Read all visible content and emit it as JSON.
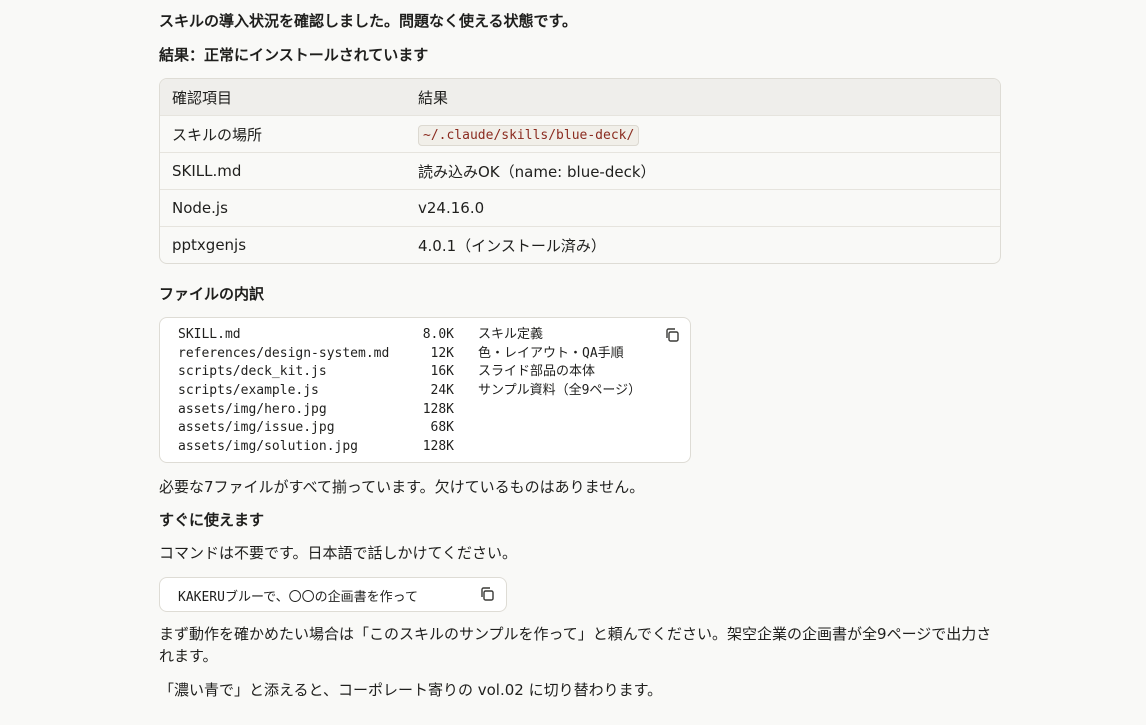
{
  "intro": "スキルの導入状況を確認しました。問題なく使える状態です。",
  "result_heading": "結果：正常にインストールされています",
  "table": {
    "headers": [
      "確認項目",
      "結果"
    ],
    "rows": [
      [
        "スキルの場所",
        "~/.claude/skills/blue-deck/"
      ],
      [
        "SKILL.md",
        "読み込みOK（name: blue-deck）"
      ],
      [
        "Node.js",
        "v24.16.0"
      ],
      [
        "pptxgenjs",
        "4.0.1（インストール済み）"
      ]
    ]
  },
  "files_heading": "ファイルの内訳",
  "files": [
    {
      "path": "SKILL.md",
      "size": "8.0K",
      "desc": "スキル定義"
    },
    {
      "path": "references/design-system.md",
      "size": "12K",
      "desc": "色・レイアウト・QA手順"
    },
    {
      "path": "scripts/deck_kit.js",
      "size": "16K",
      "desc": "スライド部品の本体"
    },
    {
      "path": "scripts/example.js",
      "size": "24K",
      "desc": "サンプル資料（全9ページ）"
    },
    {
      "path": "assets/img/hero.jpg",
      "size": "128K",
      "desc": ""
    },
    {
      "path": "assets/img/issue.jpg",
      "size": "68K",
      "desc": ""
    },
    {
      "path": "assets/img/solution.jpg",
      "size": "128K",
      "desc": ""
    }
  ],
  "files_note": "必要な7ファイルがすべて揃っています。欠けているものはありません。",
  "ready_heading": "すぐに使えます",
  "ready_text": "コマンドは不要です。日本語で話しかけてください。",
  "command": "KAKERUブルーで、〇〇の企画書を作って",
  "sample_text": "まず動作を確かめたい場合は「このスキルのサンプルを作って」と頼んでください。架空企業の企画書が全9ページで出力されます。",
  "variant_text": "「濃い青で」と添えると、コーポレート寄りの vol.02 に切り替わります。",
  "icons": {
    "copy": "copy-icon"
  }
}
